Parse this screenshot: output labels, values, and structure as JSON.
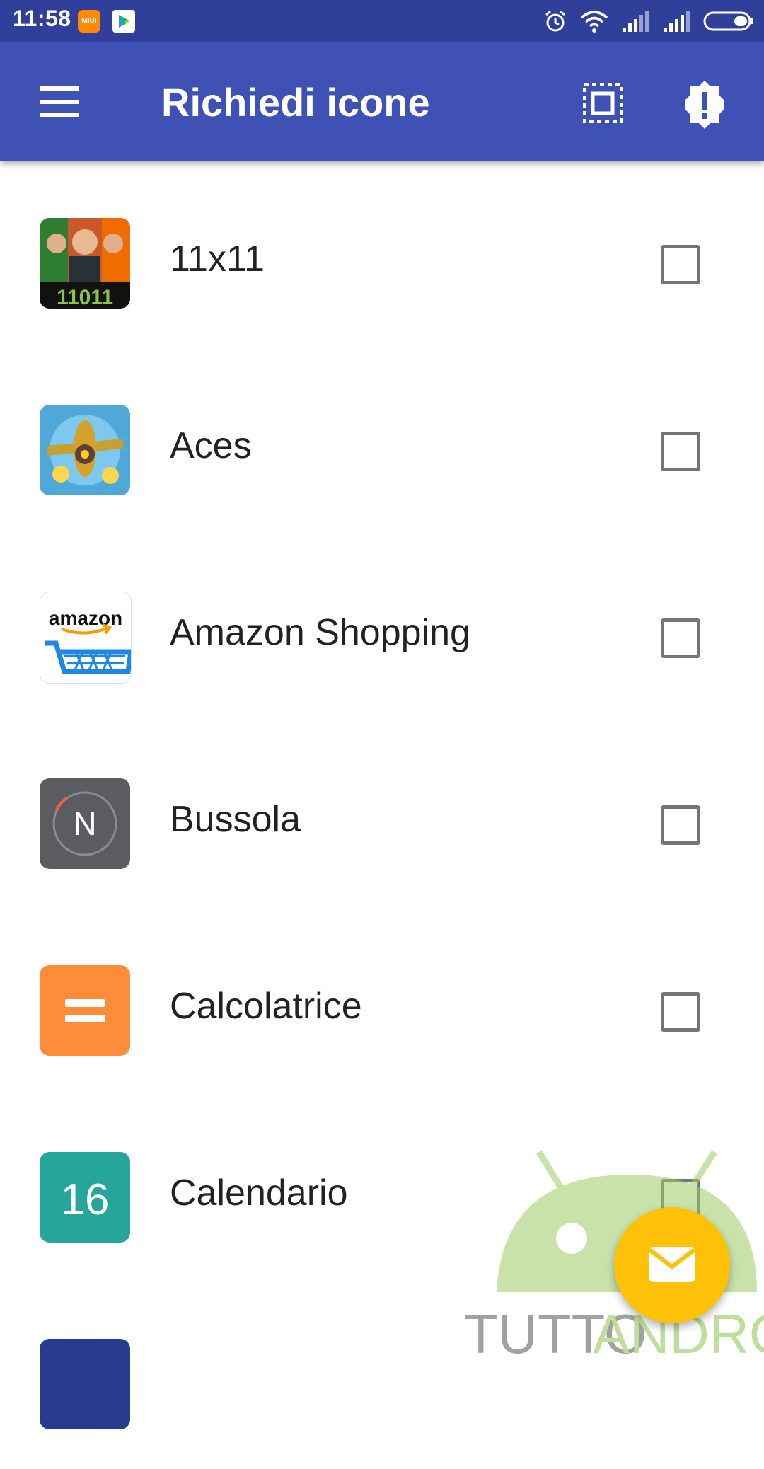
{
  "status_bar": {
    "time": "11:58",
    "miui_badge": "MIUI",
    "icons": [
      "miui-notification-icon",
      "play-store-icon",
      "alarm-icon",
      "wifi-icon",
      "signal-icon",
      "signal-icon",
      "battery-icon"
    ]
  },
  "app_bar": {
    "title": "Richiedi icone",
    "icons": [
      "menu-icon",
      "select-all-icon",
      "alert-badge-icon"
    ]
  },
  "apps": [
    {
      "label": "11x11",
      "checked": false,
      "icon": "11x11-app-icon"
    },
    {
      "label": "Aces",
      "checked": false,
      "icon": "aces-app-icon"
    },
    {
      "label": "Amazon Shopping",
      "checked": false,
      "icon": "amazon-app-icon"
    },
    {
      "label": "Bussola",
      "checked": false,
      "icon": "compass-app-icon"
    },
    {
      "label": "Calcolatrice",
      "checked": false,
      "icon": "calculator-app-icon"
    },
    {
      "label": "Calendario",
      "checked": false,
      "icon": "calendar-app-icon"
    }
  ],
  "icon_text": {
    "amazon": "amazon",
    "bussola": "N",
    "calendario": "16",
    "elevenxeleven": "11011"
  },
  "watermark": {
    "part1": "TUTTO",
    "part2": "ANDROID"
  },
  "fab": {
    "icon": "mail-icon"
  },
  "colors": {
    "status_bar": "#30409a",
    "app_bar": "#3f51b5",
    "fab": "#ffc107",
    "calc_icon": "#ff8c38",
    "calendar_icon": "#26a69a",
    "compass_icon": "#5a5c60"
  }
}
